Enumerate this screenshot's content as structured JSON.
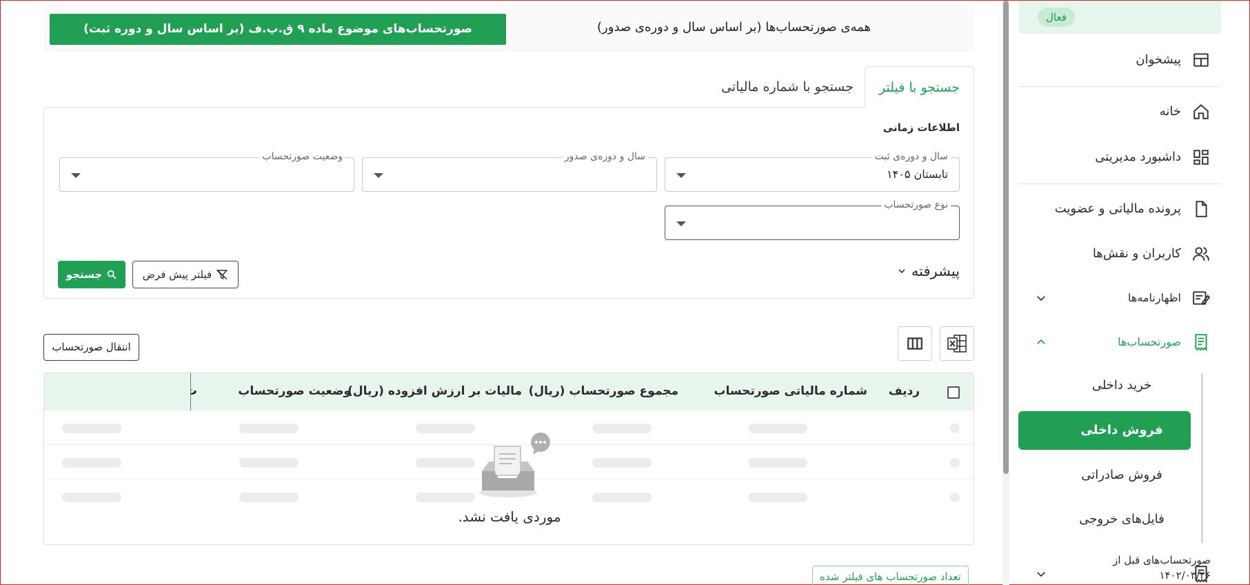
{
  "colors": {
    "primary": "#21a055",
    "primary_light": "#e8f5ec",
    "frame": "#c62828"
  },
  "sidebar": {
    "status_badge": "فعال",
    "items": [
      {
        "label": "پیشخوان",
        "icon": "layout-dashboard-icon"
      },
      {
        "label": "خانه",
        "icon": "home-icon"
      },
      {
        "label": "داشبورد مدیریتی",
        "icon": "grid-dashboard-icon"
      },
      {
        "label": "پرونده مالیاتی و عضویت",
        "icon": "document-icon"
      },
      {
        "label": "کاربران و نقش‌ها",
        "icon": "users-icon"
      },
      {
        "label": "اظهارنامه‌ها",
        "icon": "edit-form-icon"
      },
      {
        "label": "صورتحساب‌ها",
        "icon": "receipt-icon"
      }
    ],
    "sub_items": [
      {
        "label": "خرید داخلی"
      },
      {
        "label": "فروش داخلی"
      },
      {
        "label": "فروش صادراتی"
      },
      {
        "label": "فایل‌های خروجی"
      }
    ],
    "last_item": {
      "line1": "صورتحساب‌های قبل از",
      "line2": "۱۴۰۲/۰۳/۲۶"
    }
  },
  "topbar": {
    "all_invoices": "همه‌ی صورتحساب‌ها (بر اساس سال و دوره‌ی صدور)",
    "article9_button": "صورتحساب‌های موضوع ماده ۹ ق.پ.ف (بر اساس سال و دوره ثبت)"
  },
  "tabs": [
    {
      "label": "جستجو با فیلتر",
      "active": true
    },
    {
      "label": "جستجو با شماره مالیاتی",
      "active": false
    }
  ],
  "filters": {
    "section_title": "اطلاعات زمانی",
    "reg_period": {
      "label": "سال و دوره‌ی ثبت",
      "value": "تابستان ۱۴۰۵"
    },
    "issue_period": {
      "label": "سال و دوره‌ی صدور",
      "value": ""
    },
    "status": {
      "label": "وضعیت صورتحساب",
      "value": ""
    },
    "invoice_type": {
      "label": "نوع صورتحساب",
      "value": ""
    },
    "advanced": "پیشرفته",
    "default_filter_button": "فیلتر پیش فرض",
    "search_button": "جستجو"
  },
  "toolbar": {
    "transfer_button": "انتقال صورتحساب"
  },
  "table": {
    "columns": [
      "ردیف",
      "شماره مالیاتی صورتحساب",
      "مجموع صورتحساب (ریال)",
      "مالیات بر ارزش افزوده (ریال)",
      "وضعیت صورتحساب"
    ],
    "clipped_column": "ت",
    "empty_message": "موردی یافت نشد."
  },
  "footer": {
    "filtered_count": "تعداد صورتحساب های فیلتر شده"
  }
}
